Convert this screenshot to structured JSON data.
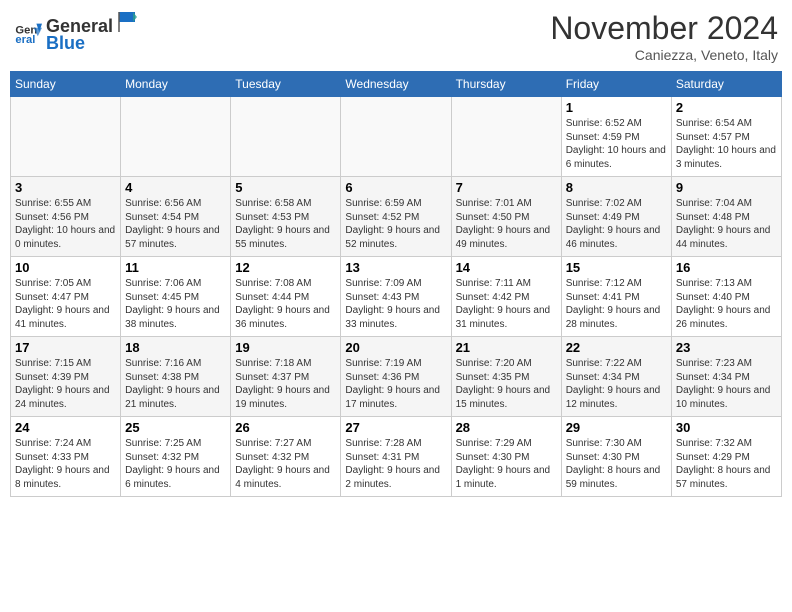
{
  "header": {
    "logo_line1": "General",
    "logo_line2": "Blue",
    "month_title": "November 2024",
    "location": "Caniezza, Veneto, Italy"
  },
  "weekdays": [
    "Sunday",
    "Monday",
    "Tuesday",
    "Wednesday",
    "Thursday",
    "Friday",
    "Saturday"
  ],
  "weeks": [
    [
      {
        "day": "",
        "info": ""
      },
      {
        "day": "",
        "info": ""
      },
      {
        "day": "",
        "info": ""
      },
      {
        "day": "",
        "info": ""
      },
      {
        "day": "",
        "info": ""
      },
      {
        "day": "1",
        "info": "Sunrise: 6:52 AM\nSunset: 4:59 PM\nDaylight: 10 hours and 6 minutes."
      },
      {
        "day": "2",
        "info": "Sunrise: 6:54 AM\nSunset: 4:57 PM\nDaylight: 10 hours and 3 minutes."
      }
    ],
    [
      {
        "day": "3",
        "info": "Sunrise: 6:55 AM\nSunset: 4:56 PM\nDaylight: 10 hours and 0 minutes."
      },
      {
        "day": "4",
        "info": "Sunrise: 6:56 AM\nSunset: 4:54 PM\nDaylight: 9 hours and 57 minutes."
      },
      {
        "day": "5",
        "info": "Sunrise: 6:58 AM\nSunset: 4:53 PM\nDaylight: 9 hours and 55 minutes."
      },
      {
        "day": "6",
        "info": "Sunrise: 6:59 AM\nSunset: 4:52 PM\nDaylight: 9 hours and 52 minutes."
      },
      {
        "day": "7",
        "info": "Sunrise: 7:01 AM\nSunset: 4:50 PM\nDaylight: 9 hours and 49 minutes."
      },
      {
        "day": "8",
        "info": "Sunrise: 7:02 AM\nSunset: 4:49 PM\nDaylight: 9 hours and 46 minutes."
      },
      {
        "day": "9",
        "info": "Sunrise: 7:04 AM\nSunset: 4:48 PM\nDaylight: 9 hours and 44 minutes."
      }
    ],
    [
      {
        "day": "10",
        "info": "Sunrise: 7:05 AM\nSunset: 4:47 PM\nDaylight: 9 hours and 41 minutes."
      },
      {
        "day": "11",
        "info": "Sunrise: 7:06 AM\nSunset: 4:45 PM\nDaylight: 9 hours and 38 minutes."
      },
      {
        "day": "12",
        "info": "Sunrise: 7:08 AM\nSunset: 4:44 PM\nDaylight: 9 hours and 36 minutes."
      },
      {
        "day": "13",
        "info": "Sunrise: 7:09 AM\nSunset: 4:43 PM\nDaylight: 9 hours and 33 minutes."
      },
      {
        "day": "14",
        "info": "Sunrise: 7:11 AM\nSunset: 4:42 PM\nDaylight: 9 hours and 31 minutes."
      },
      {
        "day": "15",
        "info": "Sunrise: 7:12 AM\nSunset: 4:41 PM\nDaylight: 9 hours and 28 minutes."
      },
      {
        "day": "16",
        "info": "Sunrise: 7:13 AM\nSunset: 4:40 PM\nDaylight: 9 hours and 26 minutes."
      }
    ],
    [
      {
        "day": "17",
        "info": "Sunrise: 7:15 AM\nSunset: 4:39 PM\nDaylight: 9 hours and 24 minutes."
      },
      {
        "day": "18",
        "info": "Sunrise: 7:16 AM\nSunset: 4:38 PM\nDaylight: 9 hours and 21 minutes."
      },
      {
        "day": "19",
        "info": "Sunrise: 7:18 AM\nSunset: 4:37 PM\nDaylight: 9 hours and 19 minutes."
      },
      {
        "day": "20",
        "info": "Sunrise: 7:19 AM\nSunset: 4:36 PM\nDaylight: 9 hours and 17 minutes."
      },
      {
        "day": "21",
        "info": "Sunrise: 7:20 AM\nSunset: 4:35 PM\nDaylight: 9 hours and 15 minutes."
      },
      {
        "day": "22",
        "info": "Sunrise: 7:22 AM\nSunset: 4:34 PM\nDaylight: 9 hours and 12 minutes."
      },
      {
        "day": "23",
        "info": "Sunrise: 7:23 AM\nSunset: 4:34 PM\nDaylight: 9 hours and 10 minutes."
      }
    ],
    [
      {
        "day": "24",
        "info": "Sunrise: 7:24 AM\nSunset: 4:33 PM\nDaylight: 9 hours and 8 minutes."
      },
      {
        "day": "25",
        "info": "Sunrise: 7:25 AM\nSunset: 4:32 PM\nDaylight: 9 hours and 6 minutes."
      },
      {
        "day": "26",
        "info": "Sunrise: 7:27 AM\nSunset: 4:32 PM\nDaylight: 9 hours and 4 minutes."
      },
      {
        "day": "27",
        "info": "Sunrise: 7:28 AM\nSunset: 4:31 PM\nDaylight: 9 hours and 2 minutes."
      },
      {
        "day": "28",
        "info": "Sunrise: 7:29 AM\nSunset: 4:30 PM\nDaylight: 9 hours and 1 minute."
      },
      {
        "day": "29",
        "info": "Sunrise: 7:30 AM\nSunset: 4:30 PM\nDaylight: 8 hours and 59 minutes."
      },
      {
        "day": "30",
        "info": "Sunrise: 7:32 AM\nSunset: 4:29 PM\nDaylight: 8 hours and 57 minutes."
      }
    ]
  ]
}
